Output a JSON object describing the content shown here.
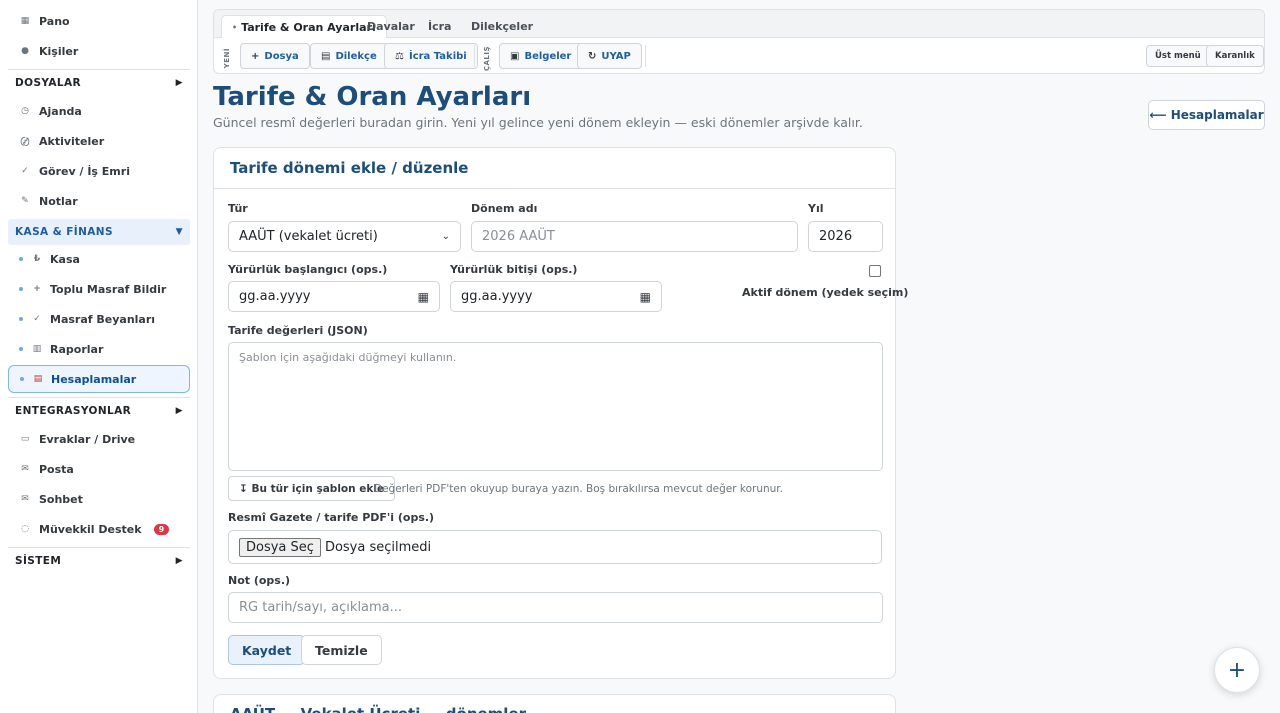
{
  "sidebar": {
    "items_top": [
      {
        "label": "Pano",
        "icon": "▦"
      },
      {
        "label": "Kişiler",
        "icon": "●"
      }
    ],
    "sec_dosyalar": {
      "label": "DOSYALAR",
      "arrow": "▶"
    },
    "items_dosyalar": [
      {
        "label": "Ajanda",
        "icon": "◷"
      },
      {
        "label": "Aktiviteler",
        "icon": "〄"
      },
      {
        "label": "Görev / İş Emri",
        "icon": "✓"
      },
      {
        "label": "Notlar",
        "icon": "✎"
      }
    ],
    "sec_kasa": {
      "label": "KASA & FİNANS",
      "arrow": "▼"
    },
    "items_kasa": [
      {
        "label": "Kasa",
        "icon": "₺"
      },
      {
        "label": "Toplu Masraf Bildir",
        "icon": "+"
      },
      {
        "label": "Masraf Beyanları",
        "icon": "✓"
      },
      {
        "label": "Raporlar",
        "icon": "▥"
      },
      {
        "label": "Hesaplamalar",
        "icon": "▤"
      }
    ],
    "sec_entegrasyonlar": {
      "label": "ENTEGRASYONLAR",
      "arrow": "▶"
    },
    "items_entegrasyonlar": [
      {
        "label": "Evraklar / Drive",
        "icon": "▭"
      },
      {
        "label": "Posta",
        "icon": "✉"
      },
      {
        "label": "Sohbet",
        "icon": "✉"
      },
      {
        "label": "Müvekkil Destek",
        "icon": "◌",
        "badge": "9"
      }
    ],
    "sec_sistem": {
      "label": "SİSTEM",
      "arrow": "▶"
    }
  },
  "topbar": {
    "tabs": [
      "Tarife & Oran Ayarları",
      "Davalar",
      "İcra",
      "Dilekçeler"
    ],
    "active_tab_dot": "•",
    "vlabel_new": "YENİ",
    "vlabel_work": "ÇALIŞ",
    "buttons": [
      {
        "label": "Dosya",
        "icon": "+"
      },
      {
        "label": "Dilekçe",
        "icon": "▤"
      },
      {
        "label": "İcra Takibi",
        "icon": "⚖"
      },
      {
        "label": "Belgeler",
        "icon": "▣"
      },
      {
        "label": "UYAP",
        "icon": "↻"
      }
    ],
    "right_buttons": [
      "Üst menü",
      "Karanlık"
    ]
  },
  "page": {
    "title": "Tarife & Oran Ayarları",
    "subtitle": "Güncel resmî değerleri buradan girin. Yeni yıl gelince yeni dönem ekleyin — eski dönemler arşivde kalır.",
    "back_button": "⟵ Hesaplamalar"
  },
  "form": {
    "card_title": "Tarife dönemi ekle / düzenle",
    "tur_label": "Tür",
    "tur_value": "AAÜT (vekalet ücreti)",
    "donem_label": "Dönem adı",
    "donem_placeholder": "2026 AAÜT",
    "yil_label": "Yıl",
    "yil_value": "2026",
    "start_label": "Yürürlük başlangıcı (ops.)",
    "start_placeholder": "gg.aa.yyyy",
    "end_label": "Yürürlük bitişi (ops.)",
    "end_placeholder": "gg.aa.yyyy",
    "active_label": "Aktif dönem (yedek seçim)",
    "json_label": "Tarife değerleri (JSON)",
    "json_placeholder": "Şablon için aşağıdaki düğmeyi kullanın.",
    "template_button": "↧ Bu tür için şablon ekle",
    "template_hint": "Değerleri PDF'ten okuyup buraya yazın. Boş bırakılırsa mevcut değer korunur.",
    "pdf_label": "Resmî Gazete / tarife PDF'i (ops.)",
    "file_button": "Dosya Seç",
    "file_status": "Dosya seçilmedi",
    "note_label": "Not (ops.)",
    "note_placeholder": "RG tarih/sayı, açıklama...",
    "save_button": "Kaydet",
    "clear_button": "Temizle"
  },
  "card2": {
    "title": "AAÜT — Vekalet Ücreti — dönemler"
  },
  "fab": {
    "icon": "+"
  }
}
